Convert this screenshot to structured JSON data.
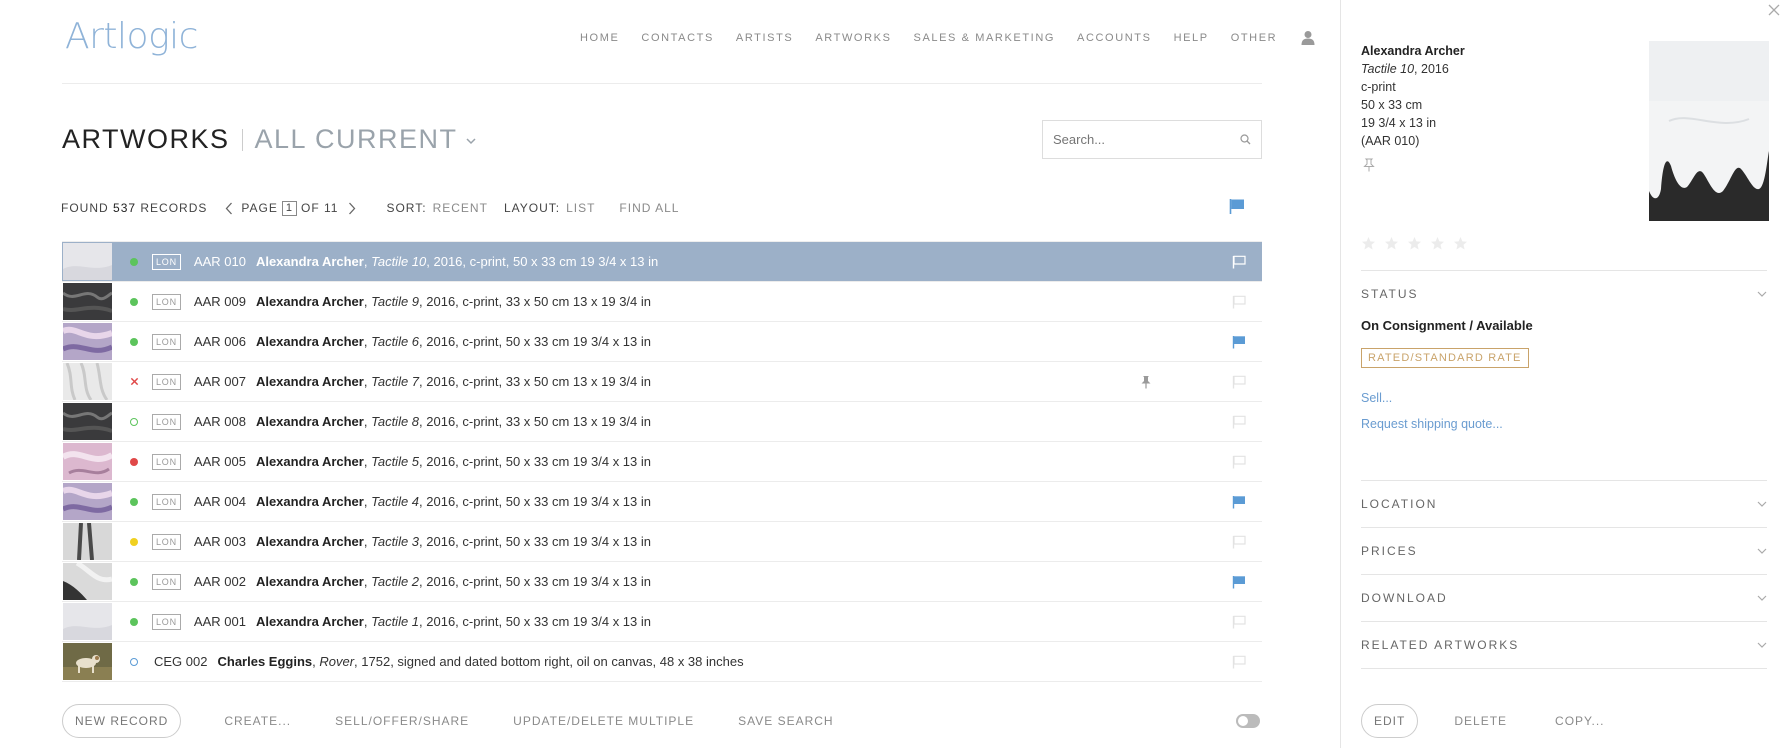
{
  "app": {
    "logo_text": "Artlogic"
  },
  "nav": {
    "items": [
      "HOME",
      "CONTACTS",
      "ARTISTS",
      "ARTWORKS",
      "SALES & MARKETING",
      "ACCOUNTS",
      "HELP",
      "OTHER"
    ]
  },
  "header": {
    "title": "ARTWORKS",
    "view": "ALL CURRENT"
  },
  "search": {
    "placeholder": "Search..."
  },
  "toolbar": {
    "found_label": "FOUND",
    "found_count": "537",
    "records_label": "RECORDS",
    "page_label": "PAGE",
    "page_current": "1",
    "page_of": "OF 11",
    "sort_label": "SORT:",
    "sort_value": "RECENT",
    "layout_label": "LAYOUT:",
    "layout_value": "LIST",
    "find_all": "FIND ALL"
  },
  "colors": {
    "selected_row": "#9cb0c8",
    "flag_blue": "#5b9bd5",
    "status_green": "#5cc45c",
    "status_red": "#e04848",
    "status_yellow": "#f0d020",
    "badge_gold": "#c9a36a"
  },
  "rows": [
    {
      "thumb": "light-gray",
      "status": "green-dot",
      "location": "LON",
      "ref": "AAR 010",
      "artist": "Alexandra Archer",
      "title": "Tactile 10",
      "details": ", 2016, c-print, 50 x 33 cm 19 3/4 x 13 in",
      "flag": "outline-white",
      "pinned": false,
      "selected": true
    },
    {
      "thumb": "dark",
      "status": "green-dot",
      "location": "LON",
      "ref": "AAR 009",
      "artist": "Alexandra Archer",
      "title": "Tactile 9",
      "details": ", 2016, c-print, 33 x 50 cm 13 x 19 3/4 in",
      "flag": "outline",
      "pinned": false,
      "selected": false
    },
    {
      "thumb": "pink-purple",
      "status": "green-dot",
      "location": "LON",
      "ref": "AAR 006",
      "artist": "Alexandra Archer",
      "title": "Tactile 6",
      "details": ", 2016, c-print, 50 x 33 cm 19 3/4 x 13 in",
      "flag": "filled",
      "pinned": false,
      "selected": false
    },
    {
      "thumb": "white-folds",
      "status": "red-x",
      "location": "LON",
      "ref": "AAR 007",
      "artist": "Alexandra Archer",
      "title": "Tactile 7",
      "details": ", 2016, c-print, 33 x 50 cm 13 x 19 3/4 in",
      "flag": "outline",
      "pinned": true,
      "selected": false
    },
    {
      "thumb": "dark",
      "status": "green-ring",
      "location": "LON",
      "ref": "AAR 008",
      "artist": "Alexandra Archer",
      "title": "Tactile 8",
      "details": ", 2016, c-print, 33 x 50 cm 13 x 19 3/4 in",
      "flag": "outline",
      "pinned": false,
      "selected": false
    },
    {
      "thumb": "pink",
      "status": "red-dot",
      "location": "LON",
      "ref": "AAR 005",
      "artist": "Alexandra Archer",
      "title": "Tactile 5",
      "details": ", 2016, c-print, 50 x 33 cm 19 3/4 x 13 in",
      "flag": "outline",
      "pinned": false,
      "selected": false
    },
    {
      "thumb": "pink-purple",
      "status": "green-dot",
      "location": "LON",
      "ref": "AAR 004",
      "artist": "Alexandra Archer",
      "title": "Tactile 4",
      "details": ", 2016, c-print, 50 x 33 cm 19 3/4 x 13 in",
      "flag": "filled",
      "pinned": false,
      "selected": false
    },
    {
      "thumb": "gray-legs",
      "status": "yellow-dot",
      "location": "LON",
      "ref": "AAR 003",
      "artist": "Alexandra Archer",
      "title": "Tactile 3",
      "details": ", 2016, c-print, 50 x 33 cm 19 3/4 x 13 in",
      "flag": "outline",
      "pinned": false,
      "selected": false
    },
    {
      "thumb": "light-gray-dark",
      "status": "green-dot",
      "location": "LON",
      "ref": "AAR 002",
      "artist": "Alexandra Archer",
      "title": "Tactile 2",
      "details": ", 2016, c-print, 50 x 33 cm 19 3/4 x 13 in",
      "flag": "filled",
      "pinned": false,
      "selected": false
    },
    {
      "thumb": "light-gray",
      "status": "green-dot",
      "location": "LON",
      "ref": "AAR 001",
      "artist": "Alexandra Archer",
      "title": "Tactile 1",
      "details": ", 2016, c-print, 50 x 33 cm 19 3/4 x 13 in",
      "flag": "outline",
      "pinned": false,
      "selected": false
    },
    {
      "thumb": "dog-painting",
      "status": "blue-ring",
      "location": "",
      "ref": "CEG 002",
      "artist": "Charles Eggins",
      "title": "Rover",
      "details": ", 1752, signed and dated bottom right, oil on canvas, 48 x 38 inches",
      "flag": "outline",
      "pinned": false,
      "selected": false
    }
  ],
  "bottom_bar": {
    "new_record": "NEW RECORD",
    "create": "CREATE...",
    "sell": "SELL/OFFER/SHARE",
    "update": "UPDATE/DELETE MULTIPLE",
    "save_search": "SAVE SEARCH"
  },
  "detail": {
    "artist": "Alexandra Archer",
    "title": "Tactile 10",
    "year": ", 2016",
    "medium": "c-print",
    "size_cm": "50 x 33 cm",
    "size_in": "19 3/4 x 13 in",
    "ref": "(AAR 010)",
    "rating": 0,
    "sections": {
      "status": "STATUS",
      "location": "LOCATION",
      "prices": "PRICES",
      "download": "DOWNLOAD",
      "related": "RELATED ARTWORKS"
    },
    "status_value": "On Consignment / Available",
    "badge": "RATED/STANDARD RATE",
    "sell_link": "Sell...",
    "shipping_link": "Request shipping quote...",
    "edit": "EDIT",
    "delete": "DELETE",
    "copy": "COPY..."
  }
}
